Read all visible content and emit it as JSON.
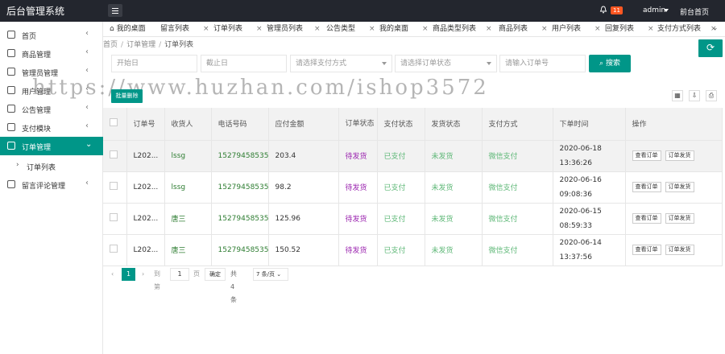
{
  "app": {
    "title": "后台管理系统"
  },
  "header": {
    "notif_count": "11",
    "user": "admin",
    "front_link": "前台首页"
  },
  "sidebar": {
    "items": [
      {
        "label": "首页",
        "icon": "home-icon"
      },
      {
        "label": "商品管理",
        "icon": "goods-icon"
      },
      {
        "label": "管理员管理",
        "icon": "admin-icon"
      },
      {
        "label": "用户管理",
        "icon": "user-icon"
      },
      {
        "label": "公告管理",
        "icon": "notice-icon"
      },
      {
        "label": "支付模块",
        "icon": "pay-icon"
      },
      {
        "label": "订单管理",
        "icon": "order-icon"
      },
      {
        "label": "留言评论管理",
        "icon": "comment-icon"
      }
    ],
    "sub_item": "订单列表"
  },
  "tabs": [
    "我的桌面",
    "留言列表",
    "订单列表",
    "管理员列表",
    "公告类型",
    "我的桌面",
    "商品类型列表",
    "商品列表",
    "用户列表",
    "回复列表",
    "支付方式列表"
  ],
  "breadcrumb": {
    "home": "首页",
    "section": "订单管理",
    "current": "订单列表"
  },
  "filters": {
    "start_date": "开始日",
    "end_date": "截止日",
    "pay_method": "请选择支付方式",
    "order_status": "请选择订单状态",
    "order_no": "请输入订单号",
    "search_label": "搜索"
  },
  "watermark": "https://www.huzhan.com/ishop3572",
  "toolbar": {
    "batch_delete": "批量删除"
  },
  "table": {
    "headers": [
      "订单号",
      "收货人",
      "电话号码",
      "应付金额",
      "订单状态",
      "支付状态",
      "发货状态",
      "支付方式",
      "下单时间",
      "操作"
    ],
    "rows": [
      {
        "no": "L202...",
        "name": "lssg",
        "phone": "15279458535",
        "amount": "203.4",
        "status": "待发货",
        "pay": "已支付",
        "ship": "未发货",
        "method": "微信支付",
        "date": "2020-06-18",
        "time": "13:36:26"
      },
      {
        "no": "L202...",
        "name": "lssg",
        "phone": "15279458535",
        "amount": "98.2",
        "status": "待发货",
        "pay": "已支付",
        "ship": "未发货",
        "method": "微信支付",
        "date": "2020-06-16",
        "time": "09:08:36"
      },
      {
        "no": "L202...",
        "name": "唐三",
        "phone": "15279458535",
        "amount": "125.96",
        "status": "待发货",
        "pay": "已支付",
        "ship": "未发货",
        "method": "微信支付",
        "date": "2020-06-15",
        "time": "08:59:33"
      },
      {
        "no": "L202...",
        "name": "唐三",
        "phone": "15279458535",
        "amount": "150.52",
        "status": "待发货",
        "pay": "已支付",
        "ship": "未发货",
        "method": "微信支付",
        "date": "2020-06-14",
        "time": "13:37:56"
      }
    ],
    "op_view": "查看订单",
    "op_ship": "订单发货"
  },
  "pager": {
    "current": "1",
    "goto": "到第",
    "page_input": "1",
    "page_unit": "页",
    "confirm": "确定",
    "total": "共 4 条",
    "page_size": "7 条/页"
  },
  "colors": {
    "accent": "#009688",
    "topbar": "#23262e",
    "badge": "#ff5722"
  }
}
